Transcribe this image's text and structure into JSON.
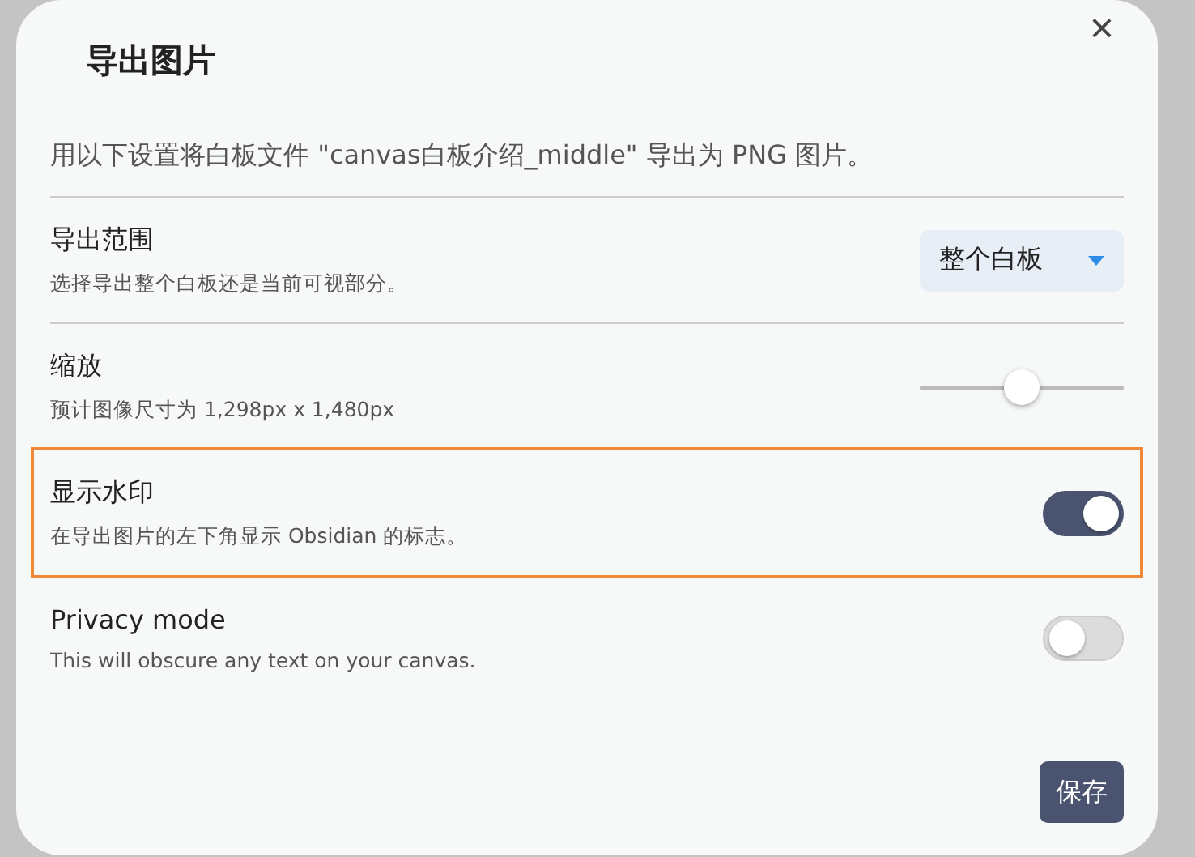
{
  "dialog": {
    "title": "导出图片",
    "close": "×",
    "description": "用以下设置将白板文件 \"canvas白板介绍_middle\" 导出为 PNG 图片。",
    "settings": [
      {
        "kind": "dropdown",
        "name": "导出范围",
        "description": "选择导出整个白板还是当前可视部分。",
        "value": "整个白板",
        "highlighted": false
      },
      {
        "kind": "slider",
        "name": "缩放",
        "description": "预计图像尺寸为 1,298px x 1,480px",
        "level": 0.5,
        "highlighted": false
      },
      {
        "kind": "toggle",
        "name": "显示水印",
        "description": "在导出图片的左下角显示 Obsidian 的标志。",
        "on": true,
        "highlighted": true
      },
      {
        "kind": "toggle",
        "name": "Privacy mode",
        "description": "This will obscure any text on your canvas.",
        "on": false,
        "highlighted": false
      }
    ],
    "save_button": "保存"
  }
}
